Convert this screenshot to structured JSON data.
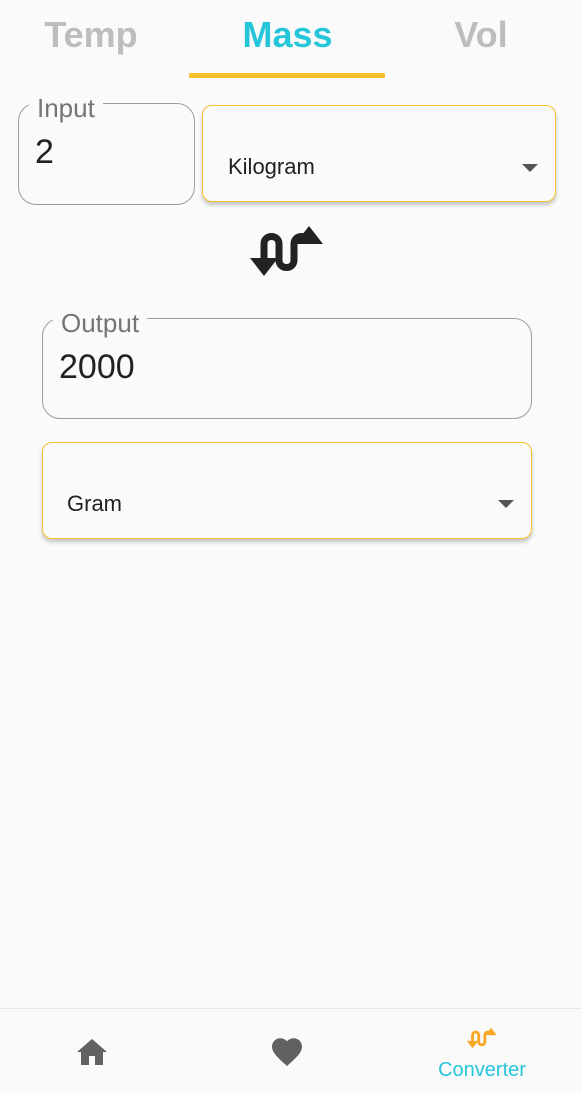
{
  "tabs": [
    {
      "label": "Temp",
      "active": false
    },
    {
      "label": "Mass",
      "active": true
    },
    {
      "label": "Vol",
      "active": false
    }
  ],
  "input": {
    "label": "Input",
    "value": "2"
  },
  "from_unit": {
    "selected": "Kilogram"
  },
  "output": {
    "label": "Output",
    "value": "2000"
  },
  "to_unit": {
    "selected": "Gram"
  },
  "bottom_nav": {
    "items": [
      {
        "icon": "home-icon",
        "label": "",
        "active": false
      },
      {
        "icon": "heart-icon",
        "label": "",
        "active": false
      },
      {
        "icon": "swap-icon",
        "label": "Converter",
        "active": true
      }
    ]
  },
  "colors": {
    "accent": "#26c6da",
    "highlight": "#fbc02d",
    "inactive_tab": "#bdbdbd",
    "nav_icon": "#616161",
    "background": "#fafafa"
  }
}
